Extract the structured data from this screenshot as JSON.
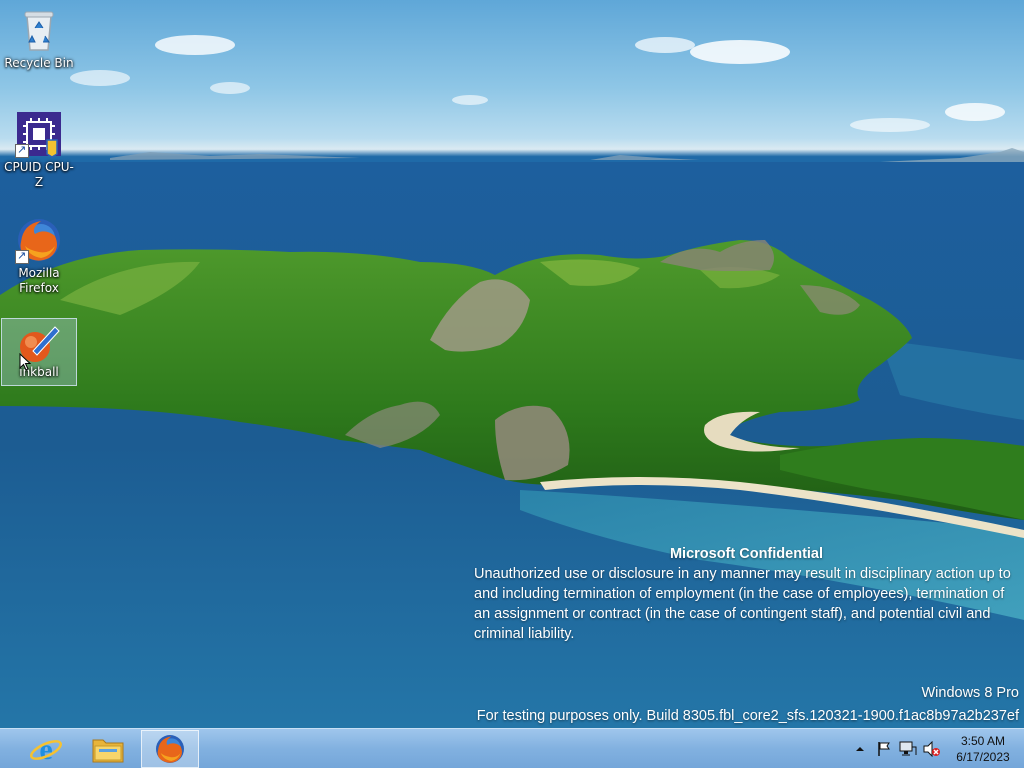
{
  "desktop": {
    "icons": [
      {
        "label": "Recycle Bin",
        "icon": "recycle-bin-icon"
      },
      {
        "label": "CPUID CPU-Z",
        "icon": "cpu-z-icon"
      },
      {
        "label": "Mozilla Firefox",
        "icon": "firefox-icon"
      },
      {
        "label": "inkball",
        "icon": "inkball-icon"
      }
    ]
  },
  "notice": {
    "title": "Microsoft Confidential",
    "body": "Unauthorized use or disclosure in any manner may result in disciplinary action up to and including termination of employment (in the case of employees), termination of an assignment or contract (in the case of contingent staff), and potential civil and criminal liability."
  },
  "watermark": {
    "edition": "Windows 8 Pro",
    "build": "For testing purposes only. Build 8305.fbl_core2_sfs.120321-1900.f1ac8b97a2b237ef"
  },
  "taskbar": {
    "pinned": [
      {
        "name": "Internet Explorer",
        "icon": "internet-explorer-icon"
      },
      {
        "name": "File Explorer",
        "icon": "file-explorer-icon"
      },
      {
        "name": "Mozilla Firefox",
        "icon": "firefox-icon",
        "active": true
      }
    ],
    "tray": {
      "icons": [
        "show-hidden-icons-chevron",
        "action-center-flag-icon",
        "network-icon",
        "volume-muted-icon"
      ],
      "time": "3:50 AM",
      "date": "6/17/2023"
    }
  }
}
